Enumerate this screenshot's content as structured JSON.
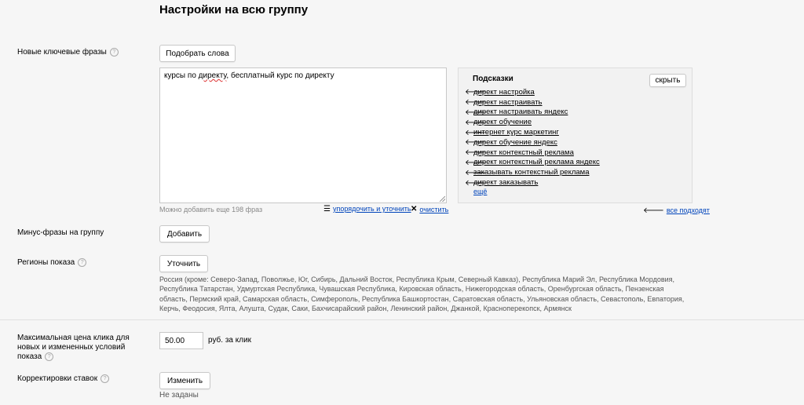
{
  "header": {
    "title": "Настройки на всю группу"
  },
  "keywords": {
    "label": "Новые ключевые фразы",
    "help": "?",
    "pick_button": "Подобрать слова",
    "text_before": "курсы по ",
    "text_marked": "директу",
    "text_after": ", бесплатный курс по директу",
    "remaining_hint": "Можно добавить еще 198 фраз",
    "organize_link": "упорядочить и уточнить",
    "clear_link": "очистить"
  },
  "suggestions": {
    "title": "Подсказки",
    "hide_button": "скрыть",
    "items": [
      "директ настройка",
      "директ настраивать",
      "директ настраивать яндекс",
      "директ обучение",
      "интернет курс маркетинг",
      "директ обучение яндекс",
      "директ контекстный реклама",
      "директ контекстный реклама яндекс",
      "заказывать контекстный реклама",
      "директ заказывать"
    ],
    "more": "ещё",
    "all_fit": "все подходят"
  },
  "minus": {
    "label": "Минус-фразы на группу",
    "add_button": "Добавить"
  },
  "regions": {
    "label": "Регионы показа",
    "help": "?",
    "refine_button": "Уточнить",
    "text": "Россия (кроме: Северо-Запад, Поволжье, Юг, Сибирь, Дальний Восток, Республика Крым, Северный Кавказ), Республика Марий Эл, Республика Мордовия, Республика Татарстан, Удмуртская Республика, Чувашская Республика, Кировская область, Нижегородская область, Оренбургская область, Пензенская область, Пермский край, Самарская область, Симферополь, Республика Башкортостан, Саратовская область, Ульяновская область, Севастополь, Евпатория, Керчь, Феодосия, Ялта, Алушта, Судак, Саки, Бахчисарайский район, Ленинский район, Джанкой, Красноперекопск, Армянск"
  },
  "max_price": {
    "label": "Максимальная цена клика для новых и измененных условий показа",
    "help": "?",
    "value": "50.00",
    "unit": "руб. за клик"
  },
  "bid_adjust": {
    "label": "Корректировки ставок",
    "help": "?",
    "change_button": "Изменить",
    "status": "Не заданы"
  }
}
